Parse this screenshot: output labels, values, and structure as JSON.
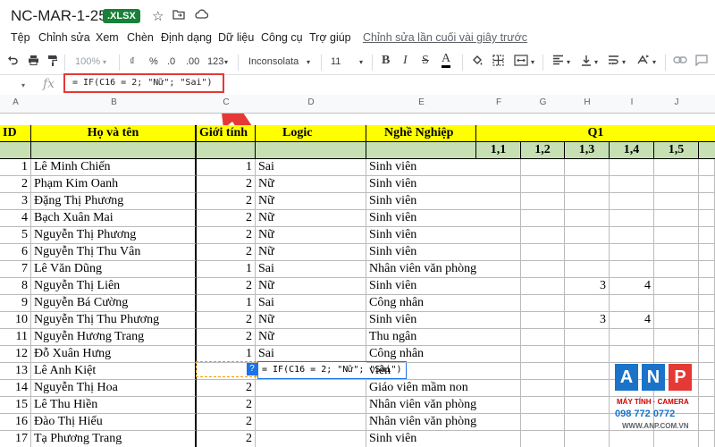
{
  "title": "NC-MAR-1-25",
  "file_badge": ".XLSX",
  "menu": [
    "Tệp",
    "Chỉnh sửa",
    "Xem",
    "Chèn",
    "Định dạng",
    "Dữ liệu",
    "Công cụ",
    "Trợ giúp"
  ],
  "menu_link": "Chỉnh sửa lần cuối vài giây trước",
  "toolbar": {
    "zoom": "100%",
    "currency": "₫",
    "percent": "%",
    "dec_less": ".0",
    "dec_more": ".00",
    "format": "123",
    "font": "Inconsolata",
    "size": "11"
  },
  "formula_bar": {
    "cell_ref": "",
    "fx": "fx",
    "formula": "= IF(C16 = 2; \"Nữ\"; \"Sai\")"
  },
  "col_letters": [
    "A",
    "B",
    "C",
    "D",
    "E",
    "F",
    "G",
    "H",
    "I",
    "J"
  ],
  "headers": {
    "id": "ID",
    "name": "Họ và tên",
    "gender": "Giới tính",
    "logic": "Logic",
    "job": "Nghề Nghiệp",
    "q1": "Q1"
  },
  "sub_headers": [
    "1,1",
    "1,2",
    "1,3",
    "1,4",
    "1,5"
  ],
  "rows": [
    {
      "id": "1",
      "name": "Lê Minh Chiến",
      "gender": "1",
      "logic": "Sai",
      "job": "Sinh viên",
      "h": "",
      "i": ""
    },
    {
      "id": "2",
      "name": "Phạm Kim Oanh",
      "gender": "2",
      "logic": "Nữ",
      "job": "Sinh viên",
      "h": "",
      "i": ""
    },
    {
      "id": "3",
      "name": "Đặng Thị Phương",
      "gender": "2",
      "logic": "Nữ",
      "job": "Sinh viên",
      "h": "",
      "i": ""
    },
    {
      "id": "4",
      "name": "Bạch Xuân Mai",
      "gender": "2",
      "logic": "Nữ",
      "job": "Sinh viên",
      "h": "",
      "i": ""
    },
    {
      "id": "5",
      "name": "Nguyễn Thị Phương",
      "gender": "2",
      "logic": "Nữ",
      "job": "Sinh viên",
      "h": "",
      "i": ""
    },
    {
      "id": "6",
      "name": "Nguyễn Thị Thu Vân",
      "gender": "2",
      "logic": "Nữ",
      "job": "Sinh viên",
      "h": "",
      "i": ""
    },
    {
      "id": "7",
      "name": "Lê Văn Dũng",
      "gender": "1",
      "logic": "Sai",
      "job": "Nhân viên văn phòng",
      "h": "",
      "i": ""
    },
    {
      "id": "8",
      "name": "Nguyễn Thị Liên",
      "gender": "2",
      "logic": "Nữ",
      "job": "Sinh viên",
      "h": "3",
      "i": "4"
    },
    {
      "id": "9",
      "name": "Nguyễn Bá Cường",
      "gender": "1",
      "logic": "Sai",
      "job": "Công nhân",
      "h": "",
      "i": ""
    },
    {
      "id": "10",
      "name": "Nguyễn Thị Thu Phương",
      "gender": "2",
      "logic": "Nữ",
      "job": "Sinh viên",
      "h": "3",
      "i": "4"
    },
    {
      "id": "11",
      "name": "Nguyễn Hương Trang",
      "gender": "2",
      "logic": "Nữ",
      "job": "Thu ngân",
      "h": "",
      "i": ""
    },
    {
      "id": "12",
      "name": "Đỗ Xuân Hưng",
      "gender": "1",
      "logic": "Sai",
      "job": "Công nhân",
      "h": "",
      "i": ""
    },
    {
      "id": "13",
      "name": "Lê Anh Kiệt",
      "gender": "",
      "logic": "",
      "job": "viên",
      "h": "",
      "i": ""
    },
    {
      "id": "14",
      "name": "Nguyễn Thị Hoa",
      "gender": "2",
      "logic": "",
      "job": "Giáo viên mầm non",
      "h": "",
      "i": ""
    },
    {
      "id": "15",
      "name": "Lê Thu Hiền",
      "gender": "2",
      "logic": "",
      "job": "Nhân viên văn phòng",
      "h": "",
      "i": ""
    },
    {
      "id": "16",
      "name": "Đào Thị Hiếu",
      "gender": "2",
      "logic": "",
      "job": "Nhân viên văn phòng",
      "h": "",
      "i": ""
    },
    {
      "id": "17",
      "name": "Tạ Phương Trang",
      "gender": "2",
      "logic": "",
      "job": "Sinh viên",
      "h": "",
      "i": ""
    }
  ],
  "autocomplete": {
    "formula": "= IF(C16 = 2; \"Nữ\"; \"Sai\")",
    "help": "?"
  },
  "watermark": {
    "letters": [
      "A",
      "N",
      "P"
    ],
    "line1": "MÁY TÍNH · CAMERA",
    "line2": "098 772 0772",
    "line3": "WWW.ANP.COM.VN"
  },
  "colors": {
    "header_yellow": "#ffff00",
    "sub_green": "#c6e0b4",
    "highlight_red": "#e53935",
    "accent_blue": "#1a73e8",
    "badge_green": "#188038"
  }
}
